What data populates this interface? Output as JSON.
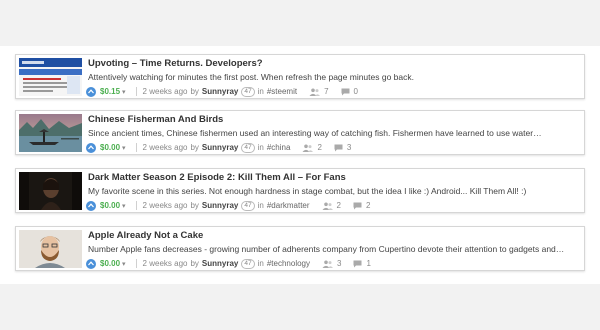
{
  "posts": [
    {
      "title": "Upvoting – Time Returns. Developers?",
      "description": "Attentively watching for minutes the first post. When refresh the page minutes go back.",
      "payout": "$0.15",
      "age": "2 weeks ago",
      "by": "by",
      "author": "Sunnyray",
      "reputation": "47",
      "in_label": "in",
      "tag": "#steemit",
      "voters": "7",
      "comments": "0",
      "thumbnail_icon": "screenshot-thumbnail"
    },
    {
      "title": "Chinese Fisherman And Birds",
      "description": "Since ancient times, Chinese fishermen used an interesting way of catching fish. Fishermen have learned to use water…",
      "payout": "$0.00",
      "age": "2 weeks ago",
      "by": "by",
      "author": "Sunnyray",
      "reputation": "47",
      "in_label": "in",
      "tag": "#china",
      "voters": "2",
      "comments": "3",
      "thumbnail_icon": "fisherman-photo-thumbnail"
    },
    {
      "title": "Dark Matter Season 2 Episode 2: Kill Them All – For Fans",
      "description": "My favorite scene in this series. Not enough hardness in stage combat, but the idea I like :) Android... Kill Them All! :)",
      "payout": "$0.00",
      "age": "2 weeks ago",
      "by": "by",
      "author": "Sunnyray",
      "reputation": "47",
      "in_label": "in",
      "tag": "#darkmatter",
      "voters": "2",
      "comments": "2",
      "thumbnail_icon": "dark-scene-thumbnail"
    },
    {
      "title": "Apple Already Not a Cake",
      "description": "Number Apple fans decreases - growing number of adherents company from Cupertino devote their attention to gadgets and…",
      "payout": "$0.00",
      "age": "2 weeks ago",
      "by": "by",
      "author": "Sunnyray",
      "reputation": "47",
      "in_label": "in",
      "tag": "#technology",
      "voters": "3",
      "comments": "1",
      "thumbnail_icon": "portrait-photo-thumbnail"
    }
  ],
  "colors": {
    "upvote": "#4a90d9",
    "payout": "#4caf50",
    "title": "#333333",
    "page_background": "#f2f2f2"
  }
}
